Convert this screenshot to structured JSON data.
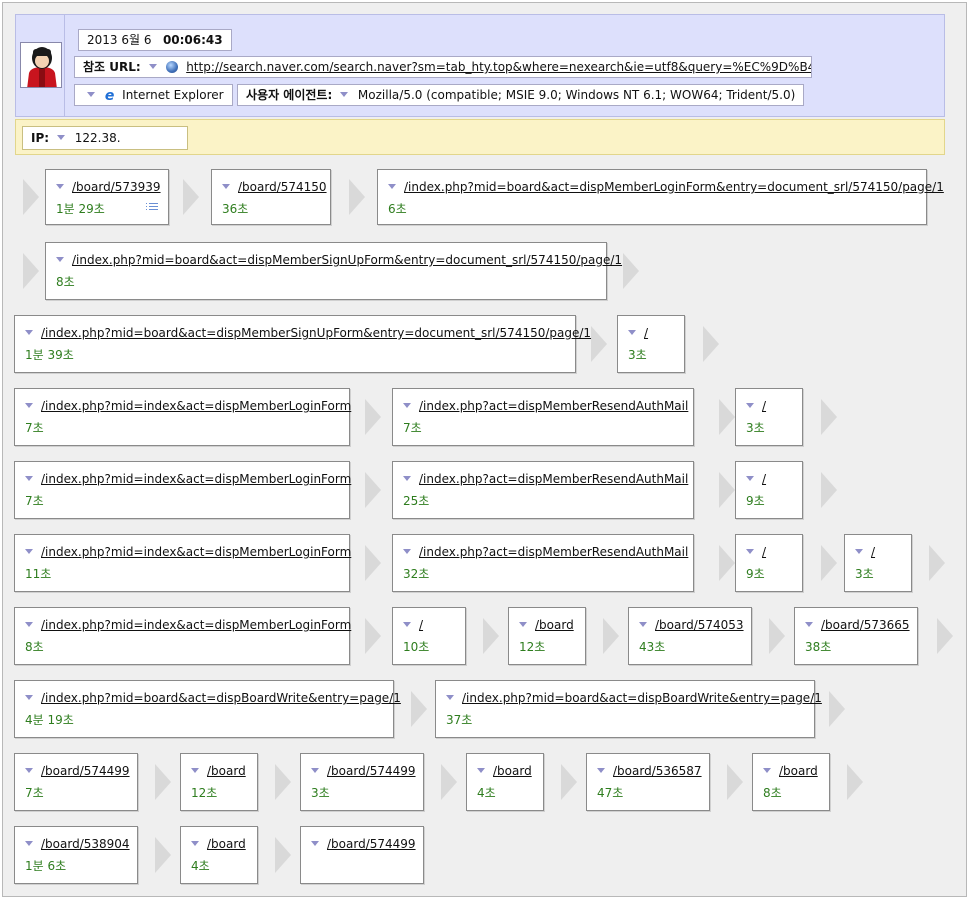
{
  "header": {
    "datetime": {
      "date": "2013 6월 6",
      "time": "00:06:43"
    },
    "referrer": {
      "label": "참조 URL:",
      "url": "http://search.naver.com/search.naver?sm=tab_hty.top&where=nexearch&ie=utf8&query=%EC%9D%B4..."
    },
    "browser": {
      "name": "Internet Explorer",
      "icon": "ie-icon"
    },
    "user_agent": {
      "label": "사용자 에이전트:",
      "value": "Mozilla/5.0 (compatible; MSIE 9.0; Windows NT 6.1; WOW64; Trident/5.0)"
    }
  },
  "ip": {
    "label": "IP:",
    "value": "122.38."
  },
  "colors": {
    "header_bg": "#dde0fc",
    "ip_bg": "#fbf3c7",
    "duration": "#2e7d1e",
    "triangle": "#8f8fc8"
  },
  "rows": [
    [
      {
        "url": "/board/573939",
        "dur": "1분 29초",
        "list": true
      },
      {
        "url": "/board/574150",
        "dur": "36초"
      },
      {
        "url": "/index.php?mid=board&act=dispMemberLoginForm&entry=document_srl/574150/page/1",
        "dur": "6초"
      }
    ],
    [
      {
        "url": "/index.php?mid=board&act=dispMemberSignUpForm&entry=document_srl/574150/page/1",
        "dur": "8초"
      }
    ],
    [
      {
        "url": "/index.php?mid=board&act=dispMemberSignUpForm&entry=document_srl/574150/page/1",
        "dur": "1분 39초"
      },
      {
        "url": "/",
        "dur": "3초"
      }
    ],
    [
      {
        "url": "/index.php?mid=index&act=dispMemberLoginForm",
        "dur": "7초"
      },
      {
        "url": "/index.php?act=dispMemberResendAuthMail",
        "dur": "7초"
      },
      {
        "url": "/",
        "dur": "3초"
      }
    ],
    [
      {
        "url": "/index.php?mid=index&act=dispMemberLoginForm",
        "dur": "7초"
      },
      {
        "url": "/index.php?act=dispMemberResendAuthMail",
        "dur": "25초"
      },
      {
        "url": "/",
        "dur": "9초"
      }
    ],
    [
      {
        "url": "/index.php?mid=index&act=dispMemberLoginForm",
        "dur": "11초"
      },
      {
        "url": "/index.php?act=dispMemberResendAuthMail",
        "dur": "32초"
      },
      {
        "url": "/",
        "dur": "9초"
      },
      {
        "url": "/",
        "dur": "3초"
      }
    ],
    [
      {
        "url": "/index.php?mid=index&act=dispMemberLoginForm",
        "dur": "8초"
      },
      {
        "url": "/",
        "dur": "10초"
      },
      {
        "url": "/board",
        "dur": "12초"
      },
      {
        "url": "/board/574053",
        "dur": "43초"
      },
      {
        "url": "/board/573665",
        "dur": "38초"
      }
    ],
    [
      {
        "url": "/index.php?mid=board&act=dispBoardWrite&entry=page/1",
        "dur": "4분 19초"
      },
      {
        "url": "/index.php?mid=board&act=dispBoardWrite&entry=page/1",
        "dur": "37초"
      }
    ],
    [
      {
        "url": "/board/574499",
        "dur": "7초"
      },
      {
        "url": "/board",
        "dur": "12초"
      },
      {
        "url": "/board/574499",
        "dur": "3초"
      },
      {
        "url": "/board",
        "dur": "4초"
      },
      {
        "url": "/board/536587",
        "dur": "47초"
      },
      {
        "url": "/board",
        "dur": "8초"
      }
    ],
    [
      {
        "url": "/board/538904",
        "dur": "1분 6초"
      },
      {
        "url": "/board",
        "dur": "4초"
      },
      {
        "url": "/board/574499",
        "dur": ""
      }
    ]
  ]
}
